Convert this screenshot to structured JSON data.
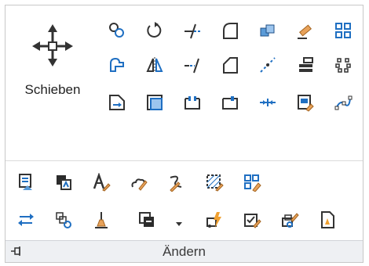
{
  "panel": {
    "title": "Ändern",
    "big_button": {
      "label": "Schieben",
      "icon": "move-icon"
    },
    "top_grid_icons": [
      "copy-icon",
      "rotate-icon",
      "trim-icon",
      "fillet-icon",
      "3d-array-icon",
      "erase-icon",
      "rectangular-array-icon",
      "stretch-icon",
      "mirror-icon",
      "extend-icon",
      "chamfer-icon",
      "break-at-point-icon",
      "draworder-icon",
      "path-array-icon",
      "scale-icon",
      "offset-icon",
      "break-icon",
      "join-icon",
      "join-lines-icon",
      "match-properties-icon",
      "polar-array-icon"
    ],
    "bottom_row1_icons": [
      "change-properties-icon",
      "copy-clip-icon",
      "text-edit-icon",
      "edit-cloud-icon",
      "edit-spline-icon",
      "edit-hatch-icon",
      "edit-array-icon"
    ],
    "bottom_row2_icons": [
      "swap-icon",
      "edit-reference-icon",
      "set-base-icon",
      "draworder-front-icon",
      "dropdown-arrow-icon",
      "lightning-block-icon",
      "edit-attribute-icon",
      "edit-block-icon",
      "text-align-icon"
    ]
  },
  "colors": {
    "accent": "#1f6fc2",
    "icon_dark": "#2b2b2b",
    "footer_bg": "#eef0f3"
  }
}
